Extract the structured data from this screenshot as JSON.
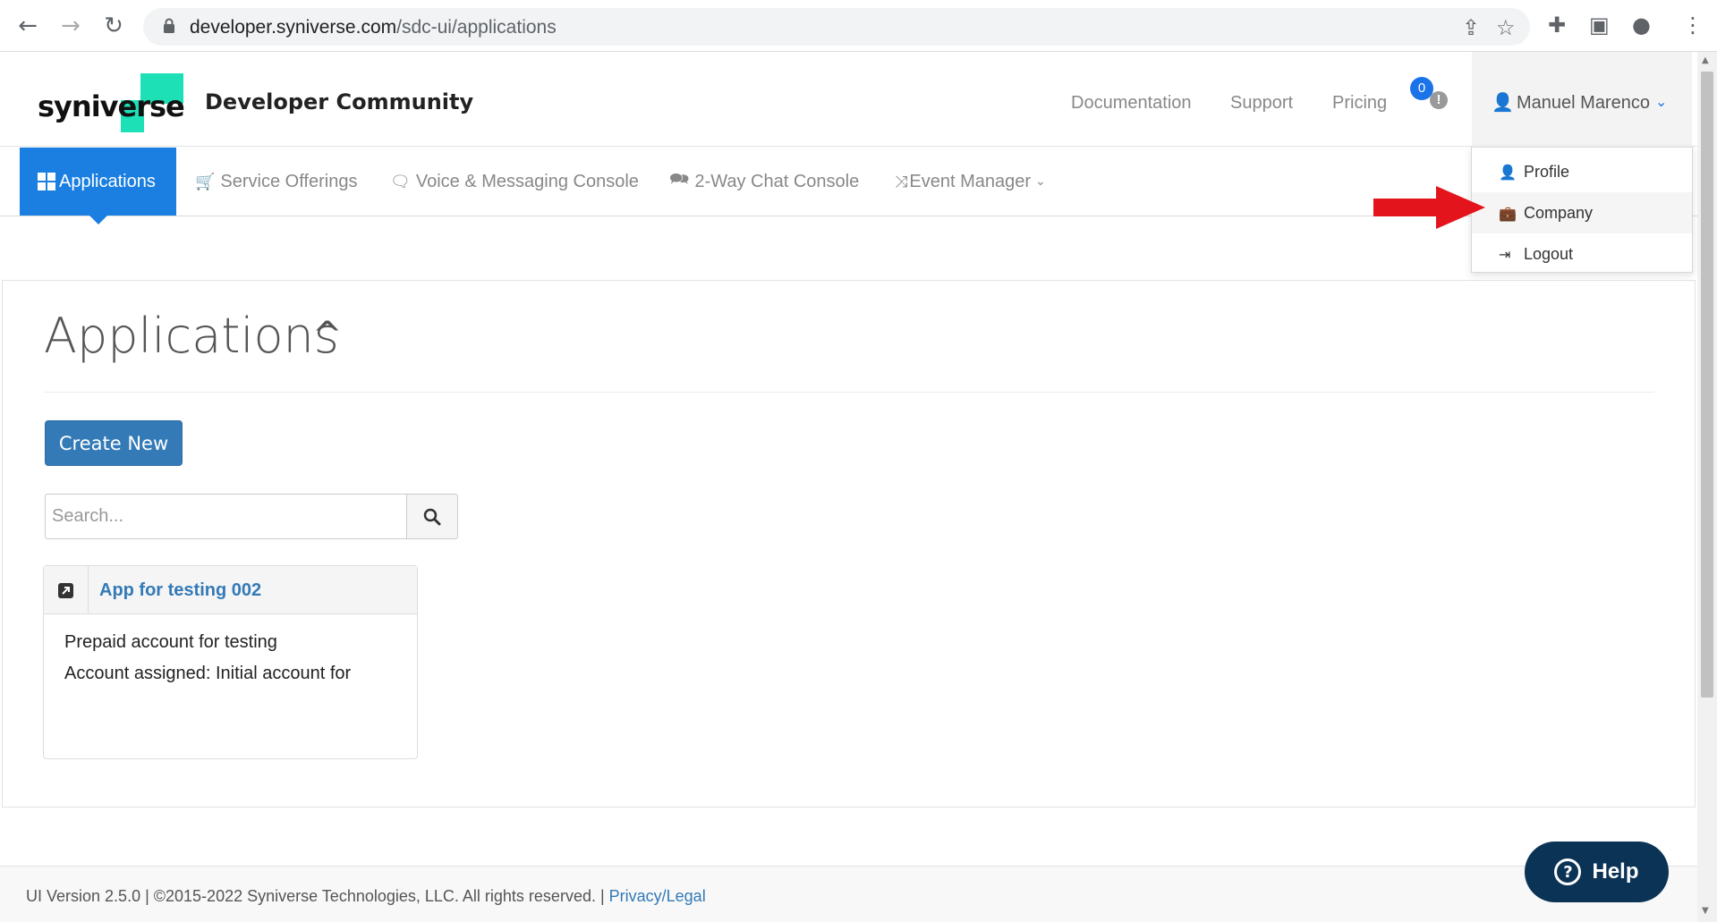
{
  "browser": {
    "url_host": "developer.syniverse.com",
    "url_path": "/sdc-ui/applications",
    "icons": [
      "back-arrow-icon",
      "forward-arrow-icon",
      "reload-icon",
      "lock-icon",
      "share-icon",
      "star-icon",
      "extensions-icon",
      "side-panel-icon",
      "profile-icon",
      "kebab-menu-icon"
    ]
  },
  "header": {
    "logo_text": "syniverse",
    "site_title": "Developer Community",
    "links": [
      "Documentation",
      "Support",
      "Pricing"
    ],
    "notification_count": "0",
    "notification_alert": "!",
    "user_name": "Manuel Marenco"
  },
  "nav": {
    "tabs": [
      {
        "label": "Applications",
        "icon": "grid-icon"
      },
      {
        "label": "Service Offerings",
        "icon": "cart-icon"
      },
      {
        "label": "Voice & Messaging Console",
        "icon": "comment-icon"
      },
      {
        "label": "2-Way Chat Console",
        "icon": "comments-icon"
      },
      {
        "label": "Event Manager",
        "icon": "shuffle-icon"
      }
    ]
  },
  "user_dropdown": {
    "items": [
      {
        "label": "Profile",
        "icon": "user-icon"
      },
      {
        "label": "Company",
        "icon": "briefcase-icon"
      },
      {
        "label": "Logout",
        "icon": "logout-icon"
      }
    ]
  },
  "main": {
    "title": "Applications",
    "create_label": "Create New",
    "search_placeholder": "Search...",
    "card": {
      "title": "App for testing 002",
      "lines": [
        "Prepaid account for testing",
        "Account assigned: Initial account for"
      ]
    }
  },
  "footer": {
    "text": "UI Version 2.5.0 | ©2015-2022 Syniverse Technologies, LLC. All rights reserved. | ",
    "link": "Privacy/Legal"
  },
  "help": {
    "label": "Help",
    "icon_glyph": "?"
  },
  "colors": {
    "accent_blue": "#1a7fe0",
    "brand_green": "#1de0b6",
    "button_blue": "#337ab7",
    "help_navy": "#0b3356",
    "arrow_red": "#e3141b"
  }
}
